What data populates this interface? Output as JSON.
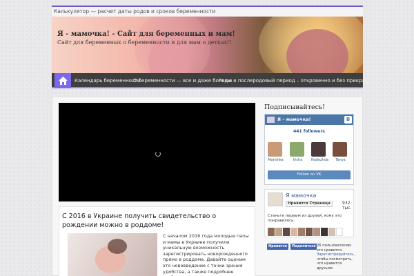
{
  "topbar": {
    "link": "Калькулятор — расчет даты родов и сроков беременности"
  },
  "header": {
    "site_title": "Я - мамочка! - Сайт для беременных и мам!",
    "site_description": "Сайт для беременных о беременности и для мам о детках!!"
  },
  "nav": {
    "home_icon": "home-icon",
    "items": [
      "Календарь беременности",
      "О беременности — все и даже больше",
      "Роды и послеродовый период – откровенно и без прикрас"
    ]
  },
  "post": {
    "title": "С 2016 в Украине получить свидетельство о рождении можно в роддоме!",
    "text": "С началом 2016 года молодые папы и мамы в Украине получили уникальную возможность зарегистрировать новорожденного прямо в роддоме. Давайте оценим это нововведение с точки зрения удобства, а также подробнее разберемся в том, как это"
  },
  "sidebar": {
    "title": "Подписывайтесь!",
    "vk": {
      "group_name": "Я – мамочка!",
      "logo": "B",
      "followers": "441 followers",
      "members": [
        {
          "name": "Marishka",
          "color": "#c99a78"
        },
        {
          "name": "Irisha",
          "color": "#8ba86d"
        },
        {
          "name": "Nadezhda",
          "color": "#4a3a3a"
        },
        {
          "name": "Tanya",
          "color": "#7a4e3c"
        }
      ],
      "follow_label": "Follow on VK"
    },
    "fb": {
      "page_name": "Я мамочка",
      "like_label": "Нравится Страница",
      "count": "932 тыс.",
      "cta": "Станьте первым из друзей, кому это понравилось.",
      "face_colors": [
        "#8a6a55",
        "#c3a28a",
        "#5e4a40",
        "#d8b7a0",
        "#a07d6a",
        "#6e5548",
        "#b59280",
        "#3e3530",
        "#d1c2b8",
        "#ffffff"
      ]
    },
    "share": {
      "like_label": "Нравится",
      "share_label": "Поделиться",
      "text_prefix": "26 пользователям это нравится.",
      "text_link": "Зарегистрируйтесь,",
      "text_suffix": "чтобы посмотреть, что нравится друзьям."
    }
  }
}
